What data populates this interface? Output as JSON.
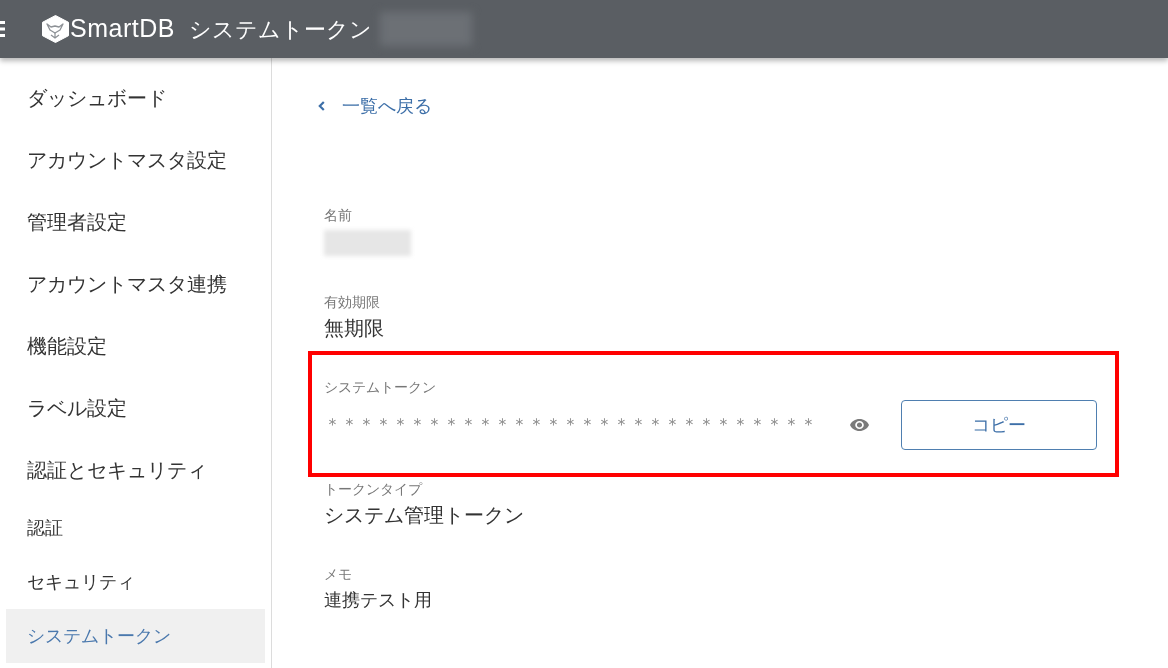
{
  "header": {
    "app_name": "SmartDB",
    "title": "システムトークン"
  },
  "sidebar": {
    "items": [
      {
        "label": "ダッシュボード",
        "selected": false
      },
      {
        "label": "アカウントマスタ設定",
        "selected": false
      },
      {
        "label": "管理者設定",
        "selected": false
      },
      {
        "label": "アカウントマスタ連携",
        "selected": false
      },
      {
        "label": "機能設定",
        "selected": false
      },
      {
        "label": "ラベル設定",
        "selected": false
      },
      {
        "label": "認証とセキュリティ",
        "selected": false,
        "children": [
          {
            "label": "認証",
            "selected": false
          },
          {
            "label": "セキュリティ",
            "selected": false
          },
          {
            "label": "システムトークン",
            "selected": true
          }
        ]
      }
    ]
  },
  "back_link": {
    "label": "一覧へ戻る"
  },
  "fields": [
    {
      "kind": "redacted",
      "label": "名前"
    },
    {
      "kind": "text",
      "label": "有効期限",
      "value": "無期限"
    },
    {
      "kind": "token",
      "label": "システムトークン",
      "value": "＊＊＊＊＊＊＊＊＊＊＊＊＊＊＊＊＊＊＊＊＊＊＊＊＊＊＊＊＊",
      "highlighted": true,
      "button": "コピー"
    },
    {
      "kind": "text",
      "label": "トークンタイプ",
      "value": "システム管理トークン"
    },
    {
      "kind": "memo",
      "label": "メモ",
      "value": "連携テスト用"
    }
  ]
}
